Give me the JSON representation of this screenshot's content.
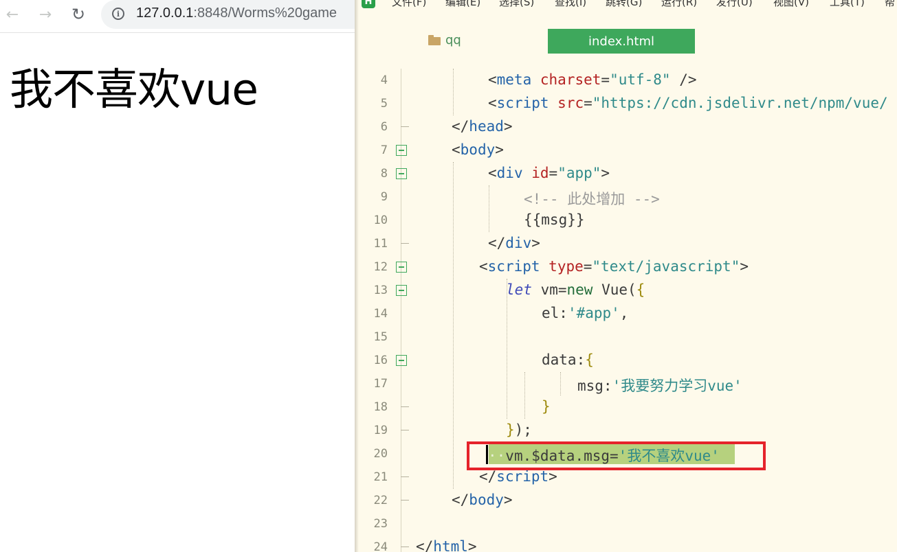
{
  "browser": {
    "url_host": "127.0.0.1",
    "url_rest": ":8848/Worms%20game",
    "page_heading": "我不喜欢vue"
  },
  "editor": {
    "menu": [
      "文件(F)",
      "编辑(E)",
      "选择(S)",
      "查找(I)",
      "跳转(G)",
      "运行(R)",
      "发行(U)",
      "视图(V)",
      "工具(T)",
      "帮"
    ],
    "project_name": "qq",
    "active_tab": "index.html",
    "line_numbers": [
      "4",
      "5",
      "6",
      "7",
      "8",
      "9",
      "10",
      "11",
      "12",
      "13",
      "14",
      "15",
      "16",
      "17",
      "18",
      "19",
      "20",
      "21",
      "22",
      "23",
      "24"
    ],
    "code": {
      "l4": [
        "<",
        "meta",
        "charset",
        "=",
        "\"utf-8\"",
        " />"
      ],
      "l5": [
        "<",
        "script",
        "src",
        "=",
        "\"https://cdn.jsdelivr.net/npm/vue/"
      ],
      "l6": [
        "</",
        "head",
        ">"
      ],
      "l7": [
        "<",
        "body",
        ">"
      ],
      "l8": [
        "<",
        "div",
        "id",
        "=",
        "\"app\"",
        ">"
      ],
      "l9": "<!-- 此处增加 -->",
      "l10": "{{msg}}",
      "l11": [
        "</",
        "div",
        ">"
      ],
      "l12": [
        "<",
        "script",
        "type",
        "=",
        "\"text/javascript\"",
        ">"
      ],
      "l13": [
        "let",
        " vm=",
        "new",
        " Vue(",
        "{"
      ],
      "l14": [
        "el:",
        "'#app'",
        ","
      ],
      "l16": [
        "data:",
        "{"
      ],
      "l17": [
        "msg:",
        "'我要努力学习vue'"
      ],
      "l18": "}",
      "l19": [
        "}",
        ");"
      ],
      "l20": [
        "··",
        "vm.$data.msg=",
        "'我不喜欢vue'"
      ],
      "l21": [
        "</",
        "script",
        ">"
      ],
      "l22": [
        "</",
        "body",
        ">"
      ],
      "l24": [
        "</",
        "html",
        ">"
      ]
    }
  }
}
